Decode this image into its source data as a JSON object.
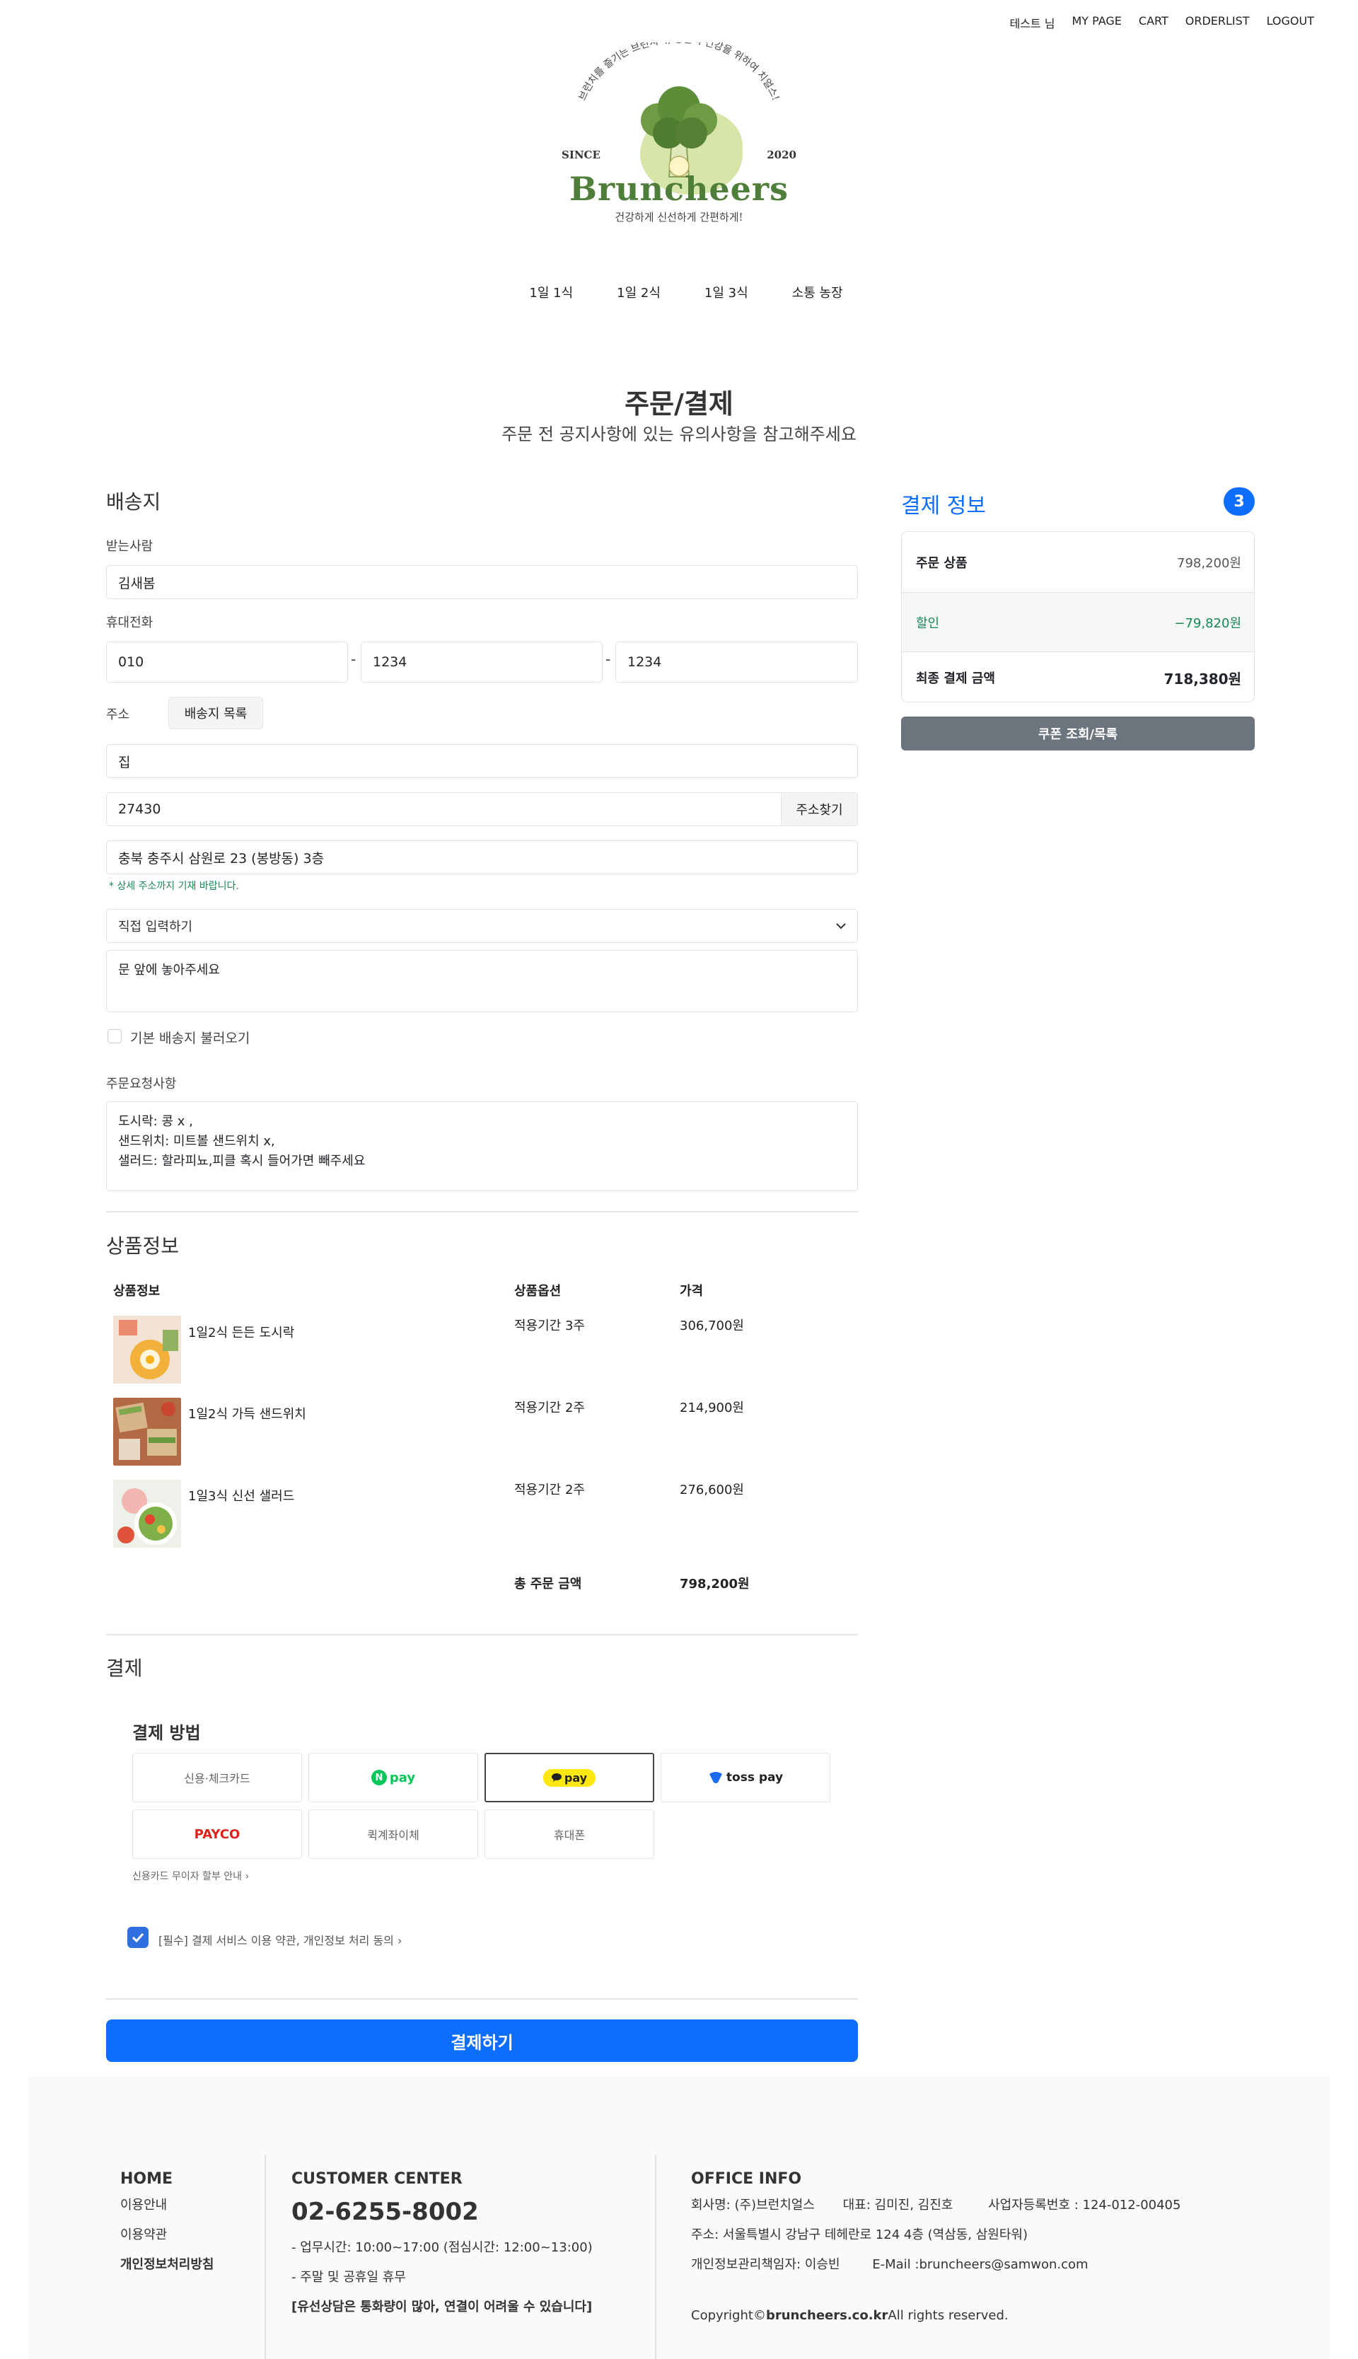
{
  "top_nav": [
    "테스트 님",
    "MY PAGE",
    "CART",
    "ORDERLIST",
    "LOGOUT"
  ],
  "logo": {
    "arc_text": "브런치를 즐기는 브런치어, 당신의 건강을 위하여 치얼스!",
    "since": "SINCE",
    "year": "2020",
    "brand": "Bruncheers",
    "tagline": "건강하게 신선하게 간편하게!"
  },
  "categories": [
    "1일 1식",
    "1일 2식",
    "1일 3식",
    "소통 농장"
  ],
  "page": {
    "title": "주문/결제",
    "subtitle": "주문 전 공지사항에 있는 유의사항을 참고해주세요"
  },
  "shipping": {
    "title": "배송지",
    "recipient_label": "받는사람",
    "recipient": "김새봄",
    "phone_label": "휴대전화",
    "phone1": "010",
    "phone2": "1234",
    "phone3": "1234",
    "dash": "-",
    "address_label": "주소",
    "address_list_button": "배송지 목록",
    "address_name": "집",
    "zipcode": "27430",
    "find_address_button": "주소찾기",
    "address": "충북 충주시 삼원로 23 (봉방동) 3층",
    "address_hint": "* 상세 주소까지 기재 바랍니다.",
    "message_select": "직접 입력하기",
    "message": "문 앞에 놓아주세요",
    "default_address_label": "기본 배송지 불러오기",
    "request_label": "주문요청사항",
    "request": "도시락: 콩 x ,\n샌드위치: 미트볼 샌드위치 x,\n샐러드: 할라피뇨,피클 혹시 들어가면 빼주세요"
  },
  "products": {
    "title": "상품정보",
    "headers": [
      "상품정보",
      "상품옵션",
      "가격"
    ],
    "items": [
      {
        "name": "1일2식 든든 도시락",
        "option": "적용기간 3주",
        "price": "306,700원"
      },
      {
        "name": "1일2식 가득 샌드위치",
        "option": "적용기간 2주",
        "price": "214,900원"
      },
      {
        "name": "1일3식 신선 샐러드",
        "option": "적용기간 2주",
        "price": "276,600원"
      }
    ],
    "total_label": "총 주문 금액",
    "total": "798,200원"
  },
  "payment": {
    "title": "결제",
    "method_title": "결제 방법",
    "methods": [
      "신용·체크카드",
      "pay",
      "pay",
      "toss pay",
      "PAYCO",
      "퀵계좌이체",
      "휴대폰"
    ],
    "npay_mark": "N",
    "note": "신용카드 무이자 할부 안내",
    "agree": "[필수] 결제 서비스 이용 약관, 개인정보 처리 동의",
    "submit": "결제하기"
  },
  "summary": {
    "title": "결제 정보",
    "badge": "3",
    "rows": [
      {
        "label": "주문 상품",
        "value": "798,200원"
      },
      {
        "label": "할인",
        "value": "−79,820원"
      },
      {
        "label": "최종 결제 금액",
        "value": "718,380원"
      }
    ],
    "coupon_button": "쿠폰 조회/목록"
  },
  "footer": {
    "links": [
      "HOME",
      "이용안내",
      "이용약관",
      "개인정보처리방침"
    ],
    "cc_title": "CUSTOMER CENTER",
    "cc_phone": "02-6255-8002",
    "cc_hours": "- 업무시간: 10:00~17:00 (점심시간: 12:00~13:00)",
    "cc_holiday": "- 주말 및 공휴일 휴무",
    "cc_note": "[유선상담은 통화량이 많아, 연결이 어려울 수 있습니다]",
    "office_title": "OFFICE INFO",
    "company": "회사명: (주)브런치얼스",
    "ceo": "대표: 김미진, 김진호",
    "bizno": "사업자등록번호 : 124-012-00405",
    "address": "주소: 서울특별시 강남구 테헤란로 124 4층 (역삼동, 삼원타워)",
    "privacy_officer": "개인정보관리책임자: 이승빈",
    "email": "E-Mail :bruncheers@samwon.com",
    "copyright_pre": "Copyright©",
    "copyright_domain": "bruncheers.co.kr",
    "copyright_post": "All rights reserved."
  },
  "colors": {
    "primary": "#0d6efd",
    "discount": "#198754",
    "brand": "#4f7d3a",
    "coupon": "#6c757d"
  }
}
